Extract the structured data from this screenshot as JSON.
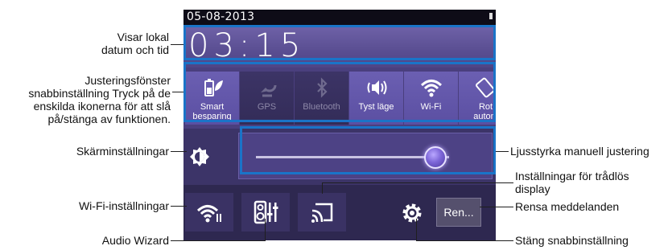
{
  "statusbar": {
    "date": "05-08-2013"
  },
  "clock": {
    "time": "03:15"
  },
  "quick_settings": [
    {
      "label": "Smart\nbesparing",
      "state": "on",
      "icon": "battery-leaf-icon"
    },
    {
      "label": "GPS",
      "state": "off",
      "icon": "gps-icon"
    },
    {
      "label": "Bluetooth",
      "state": "off",
      "icon": "bluetooth-icon"
    },
    {
      "label": "Tyst läge",
      "state": "on",
      "icon": "vibrate-icon"
    },
    {
      "label": "Wi-Fi",
      "state": "on",
      "icon": "wifi-icon"
    },
    {
      "label": "Rot\nautom",
      "state": "on",
      "icon": "rotate-icon"
    }
  ],
  "brightness": {
    "level": 0.93
  },
  "buttons": {
    "clear_label": "Ren..."
  },
  "callouts": {
    "date_time": "Visar lokal\ndatum och tid",
    "adjust_window": "Justeringsfönster\nsnabbinställning Tryck på de\nenskilda ikonerna för att slå\npå/stänga av funktionen.",
    "display_settings": "Skärminställningar",
    "wifi_settings": "Wi-Fi-inställningar",
    "audio_wizard": "Audio Wizard",
    "brightness": "Ljusstyrka manuell justering",
    "wireless_display": "Inställningar för trådlös\ndisplay",
    "clear_notifications": "Rensa meddelanden",
    "close_quick": "Stäng snabbinställning"
  },
  "colors": {
    "highlight": "#1a74c8",
    "panel": "#2e2851",
    "active_tile": "#5b4fa2"
  }
}
